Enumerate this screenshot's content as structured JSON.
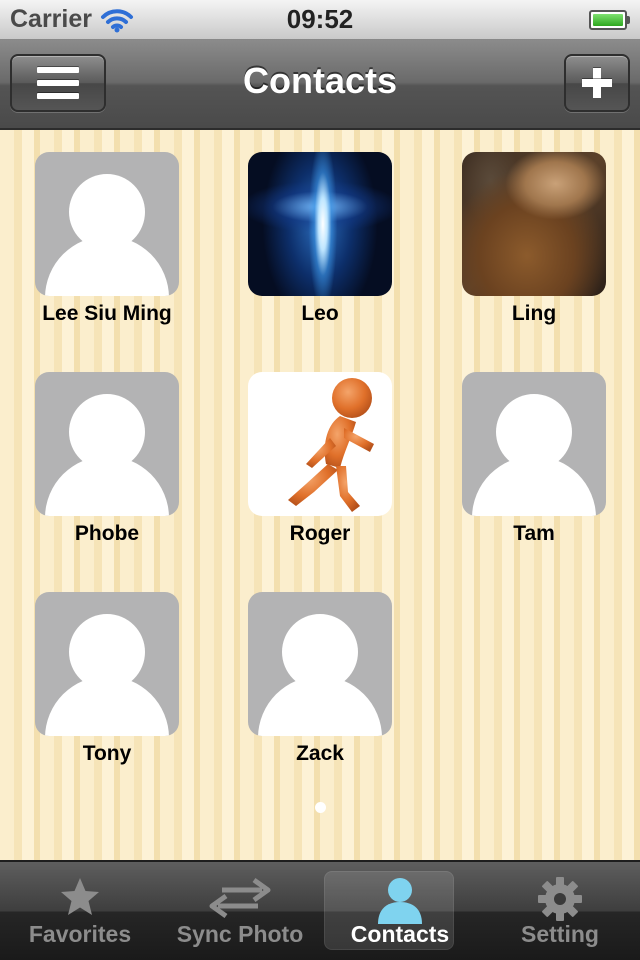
{
  "status_bar": {
    "carrier": "Carrier",
    "time": "09:52",
    "wifi_icon": "wifi-icon",
    "battery_icon": "battery-full-icon",
    "battery_color": "#2ea81f"
  },
  "nav_bar": {
    "title": "Contacts",
    "left_icon": "hamburger-menu-icon",
    "right_icon": "plus-icon"
  },
  "contacts": [
    {
      "name": "Lee Siu Ming",
      "avatar": "placeholder"
    },
    {
      "name": "Leo",
      "avatar": "photo-blue-light"
    },
    {
      "name": "Ling",
      "avatar": "photo-brown"
    },
    {
      "name": "Phobe",
      "avatar": "placeholder"
    },
    {
      "name": "Roger",
      "avatar": "photo-orange-runner"
    },
    {
      "name": "Tam",
      "avatar": "placeholder"
    },
    {
      "name": "Tony",
      "avatar": "placeholder"
    },
    {
      "name": "Zack",
      "avatar": "placeholder"
    }
  ],
  "page_indicator": {
    "pages": 1,
    "current": 1
  },
  "tab_bar": {
    "tabs": [
      {
        "label": "Favorites",
        "icon": "star-icon",
        "active": false
      },
      {
        "label": "Sync Photo",
        "icon": "sync-arrows-icon",
        "active": false
      },
      {
        "label": "Contacts",
        "icon": "person-icon",
        "active": true
      },
      {
        "label": "Setting",
        "icon": "gear-icon",
        "active": false
      }
    ],
    "active_icon_color": "#7fd3ef",
    "inactive_color": "#8c8c8c"
  }
}
